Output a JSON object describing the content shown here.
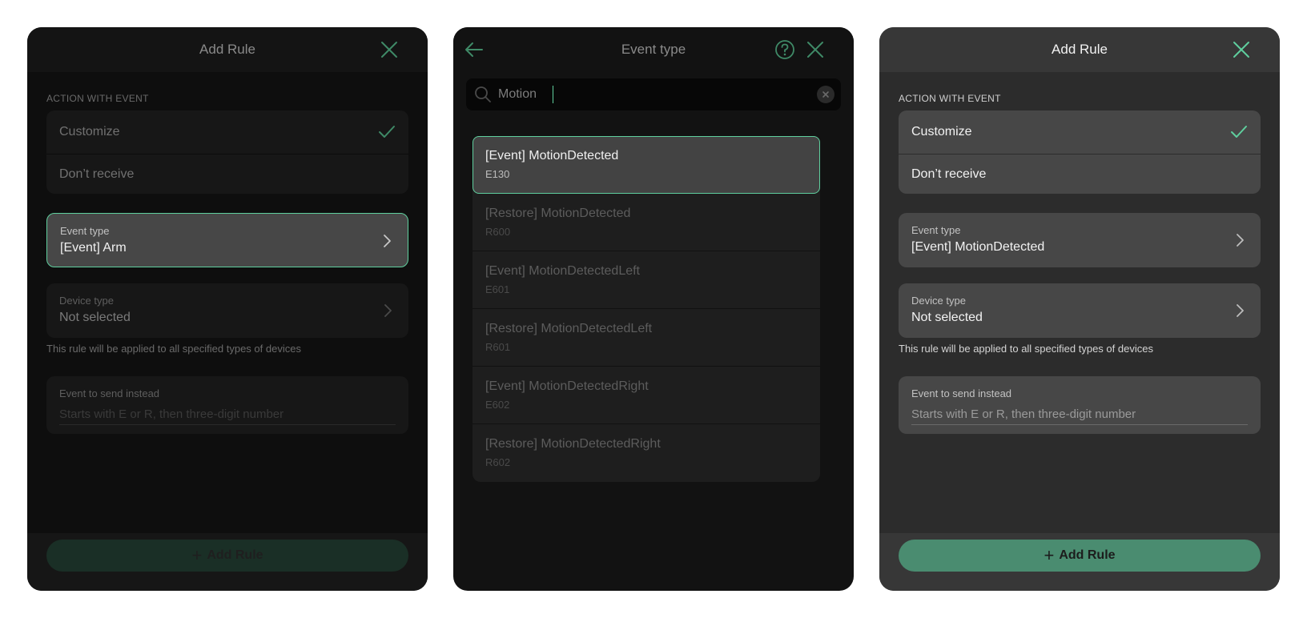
{
  "colors": {
    "accent": "#5fcf9e",
    "button_bg": "#4a8c70",
    "button_bg_dim": "#1a2f26"
  },
  "icons": {
    "close": "close-icon",
    "back": "arrow-left-icon",
    "help": "help-circle-icon",
    "check": "check-icon",
    "chevron": "chevron-right-icon",
    "search": "search-icon",
    "clear": "clear-icon",
    "plus": "plus-icon"
  },
  "panel1": {
    "title": "Add Rule",
    "action_label": "ACTION WITH EVENT",
    "options": [
      "Customize",
      "Don’t receive"
    ],
    "event_type": {
      "label": "Event type",
      "value": "[Event] Arm"
    },
    "device_type": {
      "label": "Device type",
      "value": "Not selected"
    },
    "hint": "This rule will be applied to all specified types of devices",
    "send_instead": {
      "label": "Event to send instead",
      "placeholder": "Starts with E or R, then three-digit number"
    },
    "add_button": "Add Rule"
  },
  "panel2": {
    "title": "Event type",
    "search_value": "Motion",
    "results": [
      {
        "title": "[Event] MotionDetected",
        "code": "E130"
      },
      {
        "title": "[Restore] MotionDetected",
        "code": "R600"
      },
      {
        "title": "[Event] MotionDetectedLeft",
        "code": "E601"
      },
      {
        "title": "[Restore] MotionDetectedLeft",
        "code": "R601"
      },
      {
        "title": "[Event] MotionDetectedRight",
        "code": "E602"
      },
      {
        "title": "[Restore] MotionDetectedRight",
        "code": "R602"
      }
    ]
  },
  "panel3": {
    "title": "Add Rule",
    "action_label": "ACTION WITH EVENT",
    "options": [
      "Customize",
      "Don’t receive"
    ],
    "event_type": {
      "label": "Event type",
      "value": "[Event] MotionDetected"
    },
    "device_type": {
      "label": "Device type",
      "value": "Not selected"
    },
    "hint": "This rule will be applied to all specified types of devices",
    "send_instead": {
      "label": "Event to send instead",
      "placeholder": "Starts with E or R, then three-digit number"
    },
    "add_button": "Add Rule"
  }
}
